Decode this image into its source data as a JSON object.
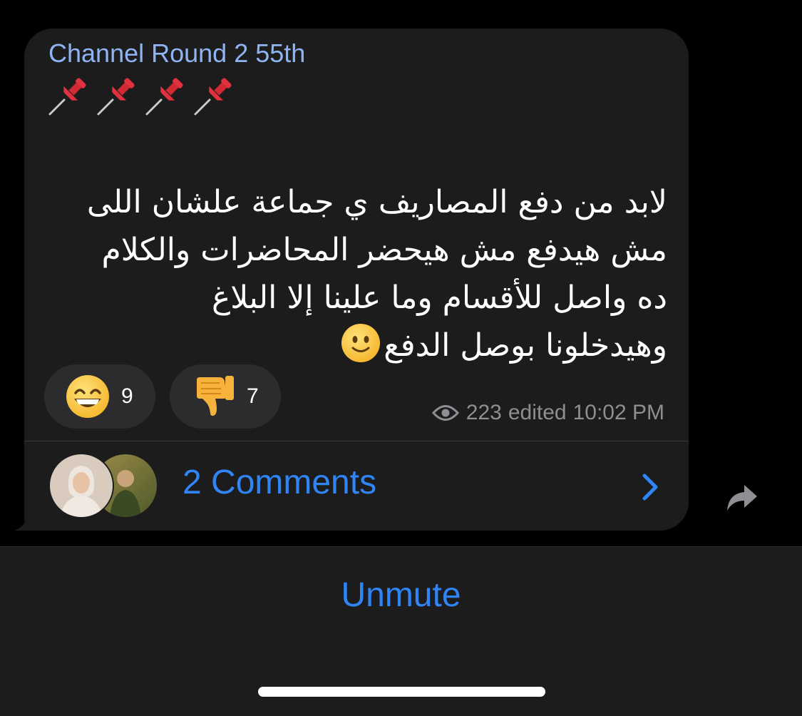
{
  "message": {
    "channel_name": "Channel Round 2 55th",
    "pin_emojis": [
      "pushpin",
      "pushpin",
      "pushpin",
      "pushpin"
    ],
    "lines": [
      "لابد من دفع المصاريف ي جماعة علشان اللى",
      "مش هيدفع مش هيحضر المحاضرات والكلام",
      "ده واصل للأقسام وما علينا إلا البلاغ",
      "وهيدخلونا بوصل الدفع"
    ],
    "trailing_emoji": "slightly-smiling-face",
    "reactions": [
      {
        "emoji": "grinning-face-with-smiling-eyes",
        "count": "9"
      },
      {
        "emoji": "thumbs-down",
        "count": "7"
      }
    ],
    "views": "223",
    "edited_label": "edited",
    "time": "10:02 PM"
  },
  "comments": {
    "label": "2 Comments"
  },
  "bottom_bar": {
    "unmute_label": "Unmute"
  },
  "colors": {
    "bubble_bg": "#1c1c1d",
    "channel_name": "#8fb4f4",
    "accent_blue": "#2f85f5",
    "meta_gray": "#8e8e93"
  }
}
